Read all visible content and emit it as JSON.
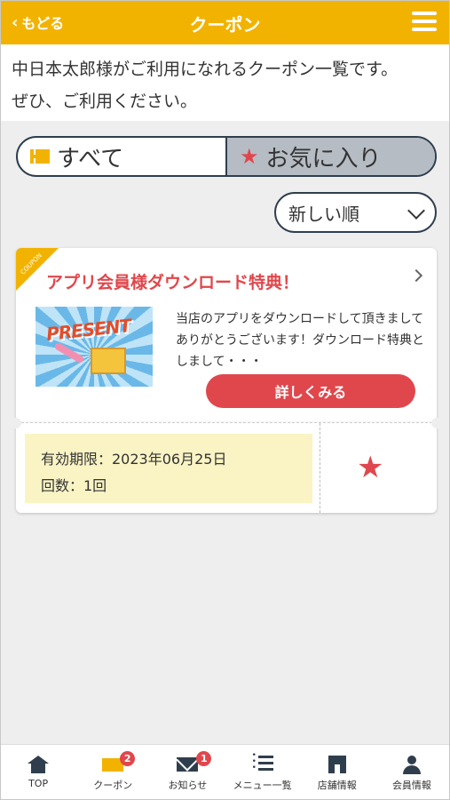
{
  "header": {
    "back_label": "もどる",
    "title": "クーポン",
    "menu_icon": "hamburger-menu-icon"
  },
  "intro": {
    "line1": "中日本太郎様がご利用になれるクーポン一覧です。",
    "line2": "ぜひ、ご利用ください。"
  },
  "tabs": [
    {
      "label": "すべて",
      "icon": "ticket-icon",
      "active": true
    },
    {
      "label": "お気に入り",
      "icon": "star-icon",
      "active": false
    }
  ],
  "sort": {
    "selected": "新しい順"
  },
  "coupon": {
    "corner_label": "COUPON",
    "title": "アプリ会員様ダウンロード特典！",
    "image_word": "PRESENT",
    "description": "当店のアプリをダウンロードして頂きましてありがとうございます！ダウンロード特典としまして・・・",
    "detail_button": "詳しくみる",
    "validity": "有効期限：2023年06月25日",
    "count": "回数：1回",
    "favorite": true
  },
  "colors": {
    "brand": "#f2b300",
    "accent": "#e0474c",
    "navy": "#2f3e4d"
  },
  "nav": [
    {
      "label": "TOP",
      "icon": "home-icon",
      "badge": ""
    },
    {
      "label": "クーポン",
      "icon": "coupon-icon",
      "badge": "2"
    },
    {
      "label": "お知らせ",
      "icon": "mail-icon",
      "badge": "1"
    },
    {
      "label": "メニュー一覧",
      "icon": "list-icon",
      "badge": ""
    },
    {
      "label": "店舗情報",
      "icon": "shop-icon",
      "badge": ""
    },
    {
      "label": "会員情報",
      "icon": "user-icon",
      "badge": ""
    }
  ]
}
